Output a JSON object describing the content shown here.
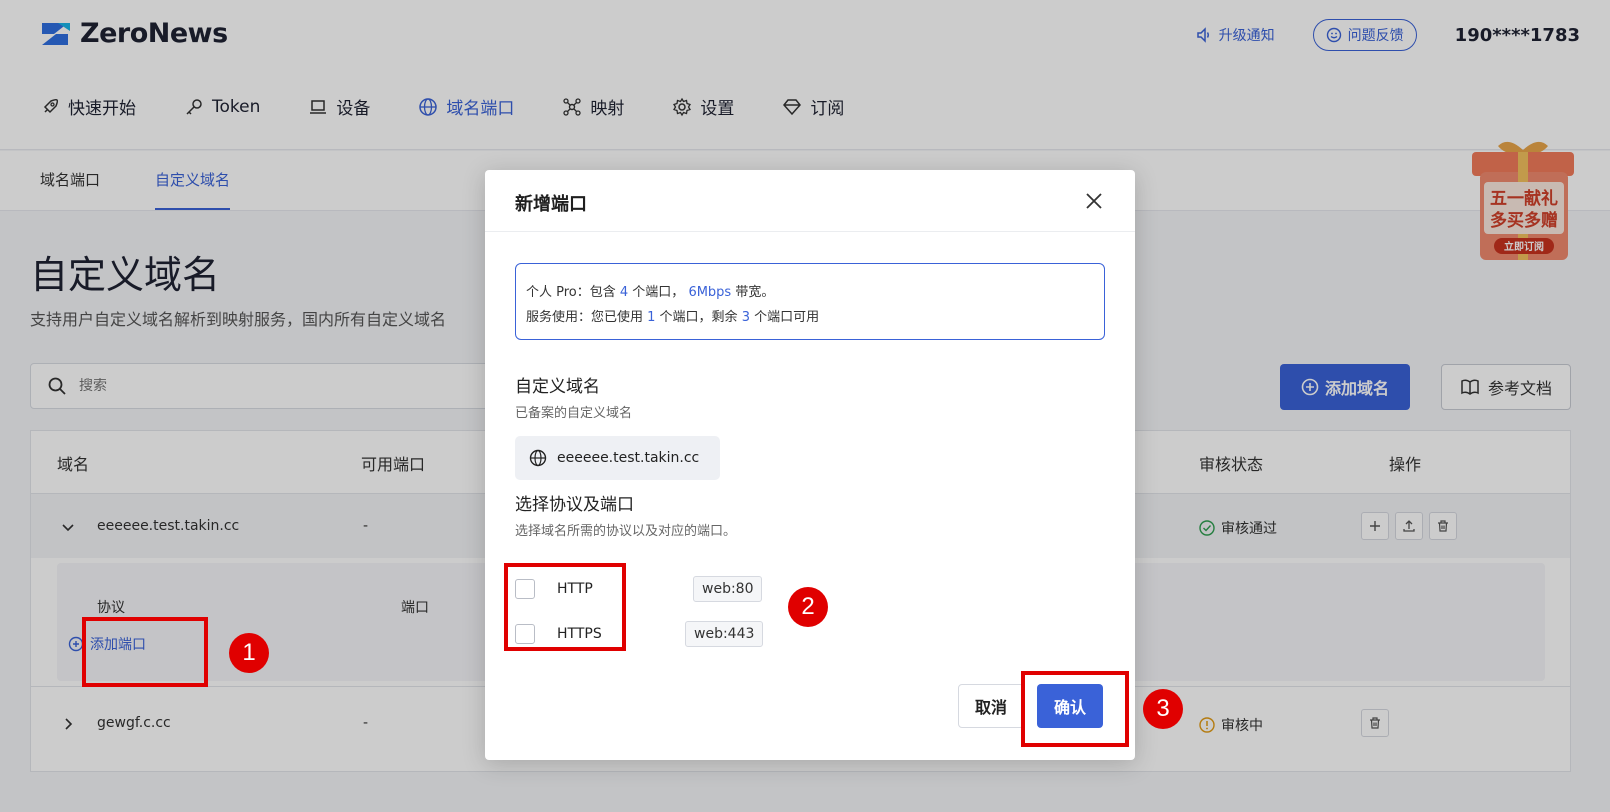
{
  "app": {
    "logo_text": "ZeroNews",
    "upgrade_label": "升级通知",
    "feedback_label": "问题反馈",
    "user_phone": "190****1783"
  },
  "main_nav": {
    "items": [
      {
        "label": "快速开始",
        "icon": "rocket-icon"
      },
      {
        "label": "Token",
        "icon": "key-icon"
      },
      {
        "label": "设备",
        "icon": "laptop-icon"
      },
      {
        "label": "域名端口",
        "icon": "globe-icon",
        "active": true
      },
      {
        "label": "映射",
        "icon": "network-icon"
      },
      {
        "label": "设置",
        "icon": "gear-icon"
      },
      {
        "label": "订阅",
        "icon": "diamond-icon"
      }
    ]
  },
  "sub_nav": {
    "tabs": [
      {
        "label": "域名端口"
      },
      {
        "label": "自定义域名",
        "active": true
      }
    ]
  },
  "page": {
    "title": "自定义域名",
    "description": "支持用户自定义域名解析到映射服务，国内所有自定义域名",
    "search_placeholder": "搜索",
    "add_domain_label": "添加域名",
    "docs_label": "参考文档"
  },
  "promo": {
    "line1": "五一献礼",
    "line2": "多买多赠",
    "cta": "立即订阅"
  },
  "table": {
    "headers": [
      "域名",
      "可用端口",
      "审核状态",
      "操作"
    ],
    "rows": [
      {
        "domain": "eeeeee.test.takin.cc",
        "ports": "-",
        "status": "审核通过",
        "status_color": "#2e9e4f",
        "expanded": true
      },
      {
        "domain": "gewgf.c.cc",
        "ports": "-",
        "status": "审核中",
        "status_color": "#e29a13",
        "expanded": false
      }
    ],
    "expanded": {
      "protocol_header": "协议",
      "port_header": "端口",
      "add_port_label": "添加端口"
    }
  },
  "modal": {
    "title": "新增端口",
    "info_line1": {
      "prefix": "个人 Pro：包含 ",
      "ports": "4",
      "mid": " 个端口， ",
      "bandwidth": "6Mbps",
      "suffix": " 带宽。"
    },
    "info_line2": {
      "prefix": "服务使用：您已使用 ",
      "used": "1",
      "mid": " 个端口，剩余 ",
      "remaining": "3",
      "suffix": " 个端口可用"
    },
    "domain_label": "自定义域名",
    "domain_hint": "已备案的自定义域名",
    "domain_value": "eeeeee.test.takin.cc",
    "protocol_label": "选择协议及端口",
    "protocol_hint": "选择域名所需的协议以及对应的端口。",
    "protocols": [
      {
        "name": "HTTP",
        "port": "web:80",
        "checked": false
      },
      {
        "name": "HTTPS",
        "port": "web:443",
        "checked": false
      }
    ],
    "cancel_label": "取消",
    "confirm_label": "确认"
  },
  "annotations": [
    "1",
    "2",
    "3"
  ],
  "colors": {
    "accent": "#3a62d8",
    "annotation_red": "#e00000"
  }
}
